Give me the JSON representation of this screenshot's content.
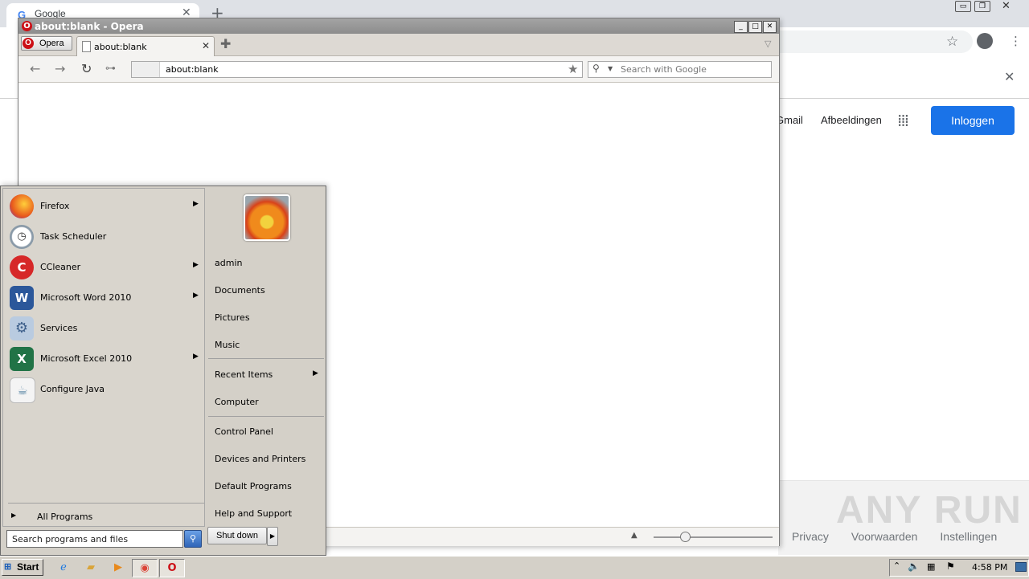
{
  "chrome": {
    "tab_title": "Google",
    "tab_close": "✕",
    "new_tab": "+",
    "google_links": [
      "Gmail",
      "Afbeeldingen"
    ],
    "signin_label": "Inloggen",
    "footer_links": [
      "Privacy",
      "Voorwaarden",
      "Instellingen"
    ],
    "watermark": "ANY RUN"
  },
  "opera": {
    "window_title": "about:blank - Opera",
    "menu_label": "Opera",
    "tab_title": "about:blank",
    "address": "about:blank",
    "search_placeholder": "Search with Google"
  },
  "start_menu": {
    "programs": [
      {
        "label": "Firefox",
        "has_submenu": true,
        "icon": "firefox-icon",
        "color": "#e8591c"
      },
      {
        "label": "Task Scheduler",
        "has_submenu": false,
        "icon": "clock-icon",
        "color": "#9aa0a6"
      },
      {
        "label": "CCleaner",
        "has_submenu": true,
        "icon": "ccleaner-icon",
        "color": "#d62828"
      },
      {
        "label": "Microsoft Word 2010",
        "has_submenu": true,
        "icon": "word-icon",
        "color": "#2b579a"
      },
      {
        "label": "Services",
        "has_submenu": false,
        "icon": "gears-icon",
        "color": "#7a9cc6"
      },
      {
        "label": "Microsoft Excel 2010",
        "has_submenu": true,
        "icon": "excel-icon",
        "color": "#217346"
      },
      {
        "label": "Configure Java",
        "has_submenu": false,
        "icon": "java-icon",
        "color": "#5382a1"
      }
    ],
    "all_programs": "All Programs",
    "search_placeholder": "Search programs and files",
    "right_links": {
      "user": "admin",
      "documents": "Documents",
      "pictures": "Pictures",
      "music": "Music",
      "recent_items": "Recent Items",
      "computer": "Computer",
      "control_panel": "Control Panel",
      "devices_printers": "Devices and Printers",
      "default_programs": "Default Programs",
      "help_support": "Help and Support"
    },
    "shutdown": "Shut down"
  },
  "taskbar": {
    "start_label": "Start",
    "clock": "4:58 PM"
  }
}
